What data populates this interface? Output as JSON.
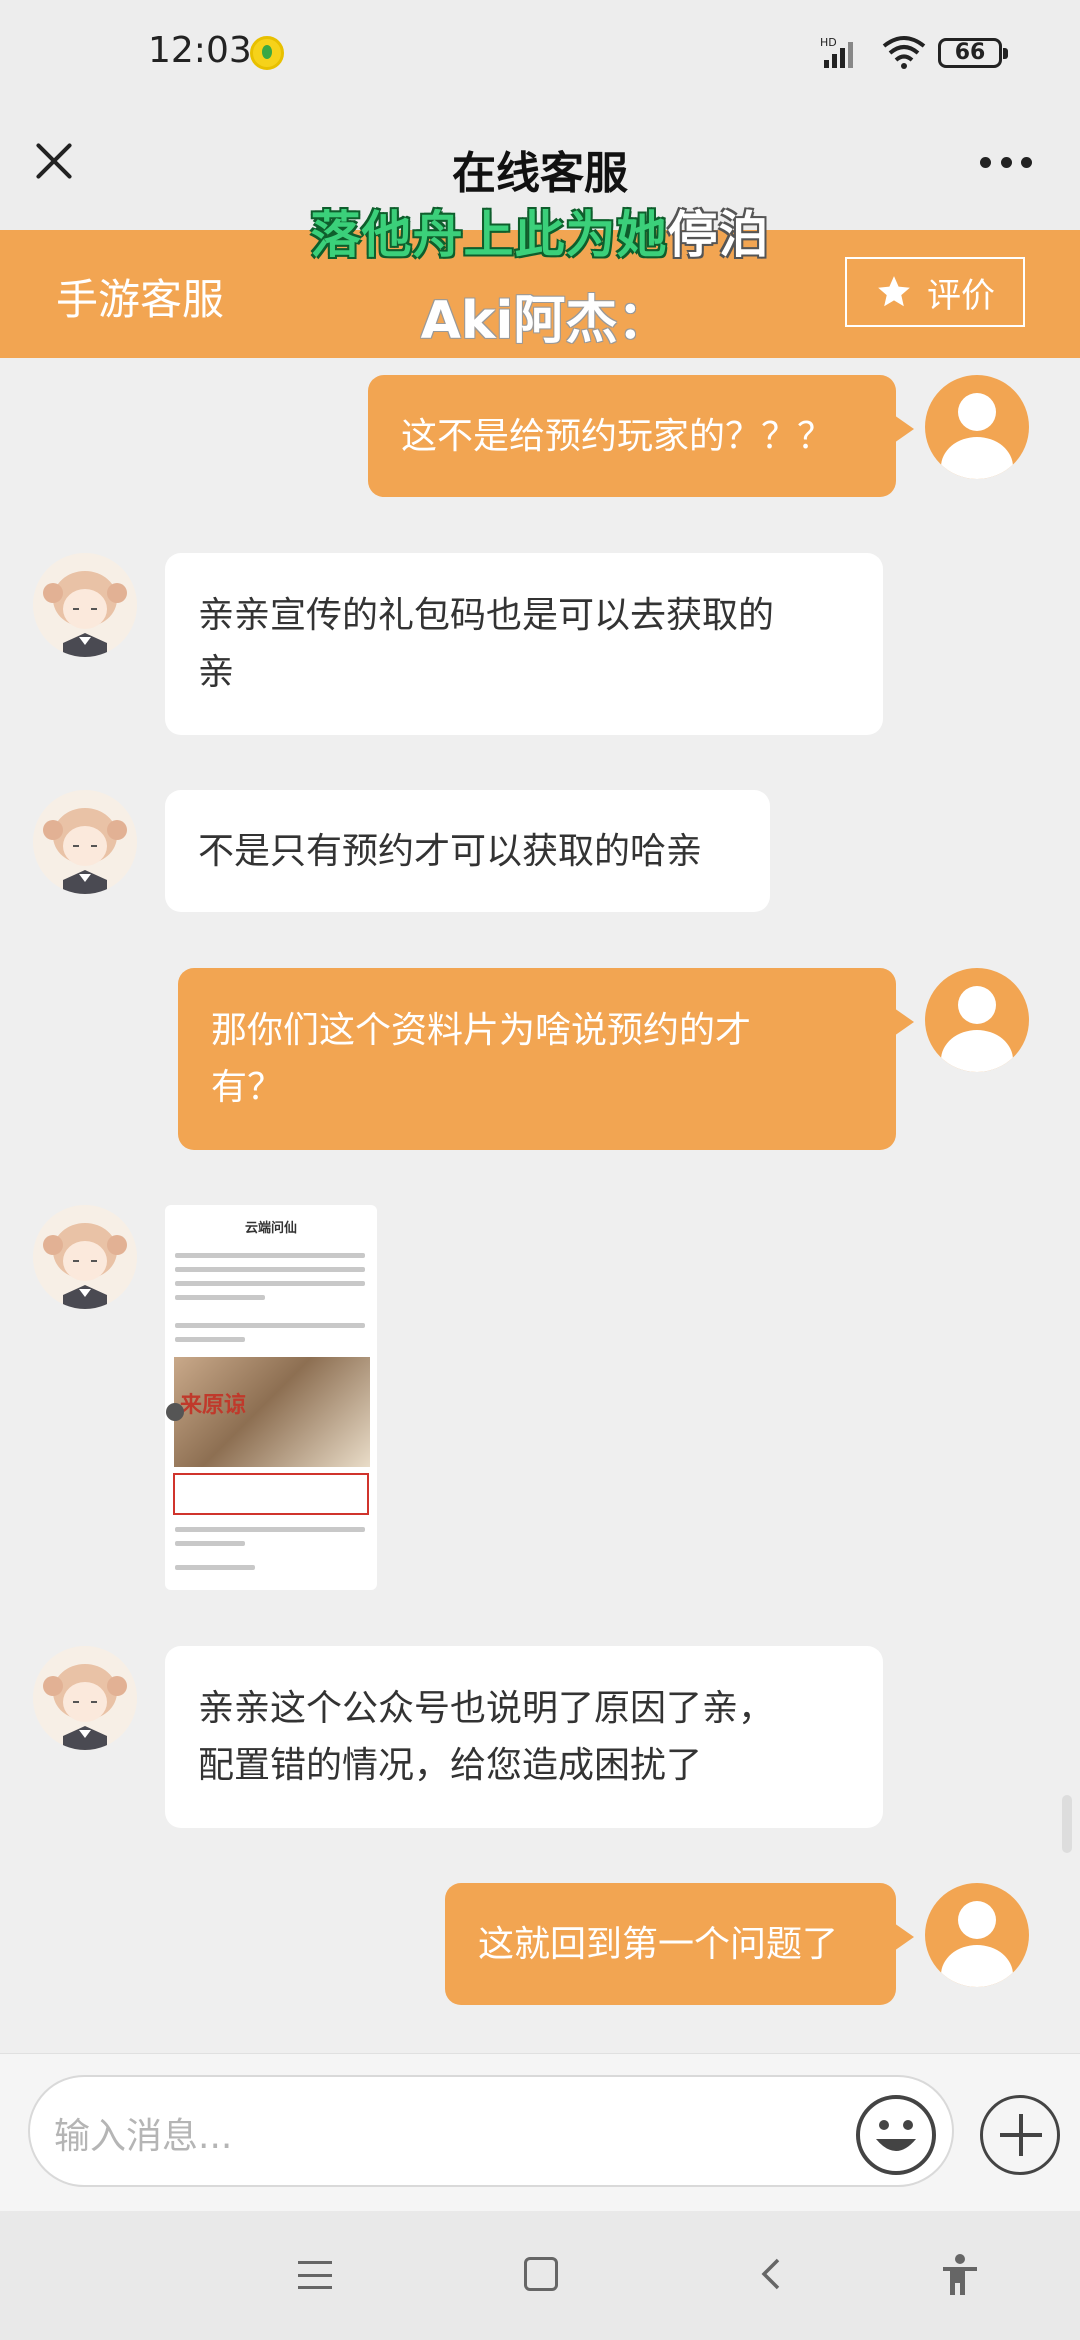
{
  "status_bar": {
    "time": "12:03",
    "network": "HD",
    "battery": "66"
  },
  "title_bar": {
    "title": "在线客服"
  },
  "caption": {
    "part1": "落他舟上此为她",
    "part2": "停泊"
  },
  "service_header": {
    "name": "手游客服",
    "agent": "Aki阿杰：",
    "rate_label": "评价"
  },
  "messages": [
    {
      "from": "user",
      "text": "这不是给预约玩家的？？？"
    },
    {
      "from": "agent",
      "text_line1": "亲亲宣传的礼包码也是可以去获取的",
      "text_line2": "亲"
    },
    {
      "from": "agent",
      "text": "不是只有预约才可以获取的哈亲"
    },
    {
      "from": "user",
      "text_line1": "那你们这个资料片为啥说预约的才",
      "text_line2": "有？"
    },
    {
      "from": "agent",
      "type": "image",
      "thumb_title": "云端问仙",
      "thumb_banner_text": "来原谅"
    },
    {
      "from": "agent",
      "text_line1": "亲亲这个公众号也说明了原因了亲，",
      "text_line2": "配置错的情况，给您造成困扰了"
    },
    {
      "from": "user",
      "text": "这就回到第一个问题了"
    }
  ],
  "input_bar": {
    "placeholder": "输入消息..."
  },
  "colors": {
    "accent": "#f2a552",
    "caption_green": "#3bd07a"
  },
  "icons": [
    "close-icon",
    "more-icon",
    "star-icon",
    "emoji-icon",
    "plus-icon",
    "menu-icon",
    "home-icon",
    "back-icon",
    "accessibility-icon"
  ]
}
